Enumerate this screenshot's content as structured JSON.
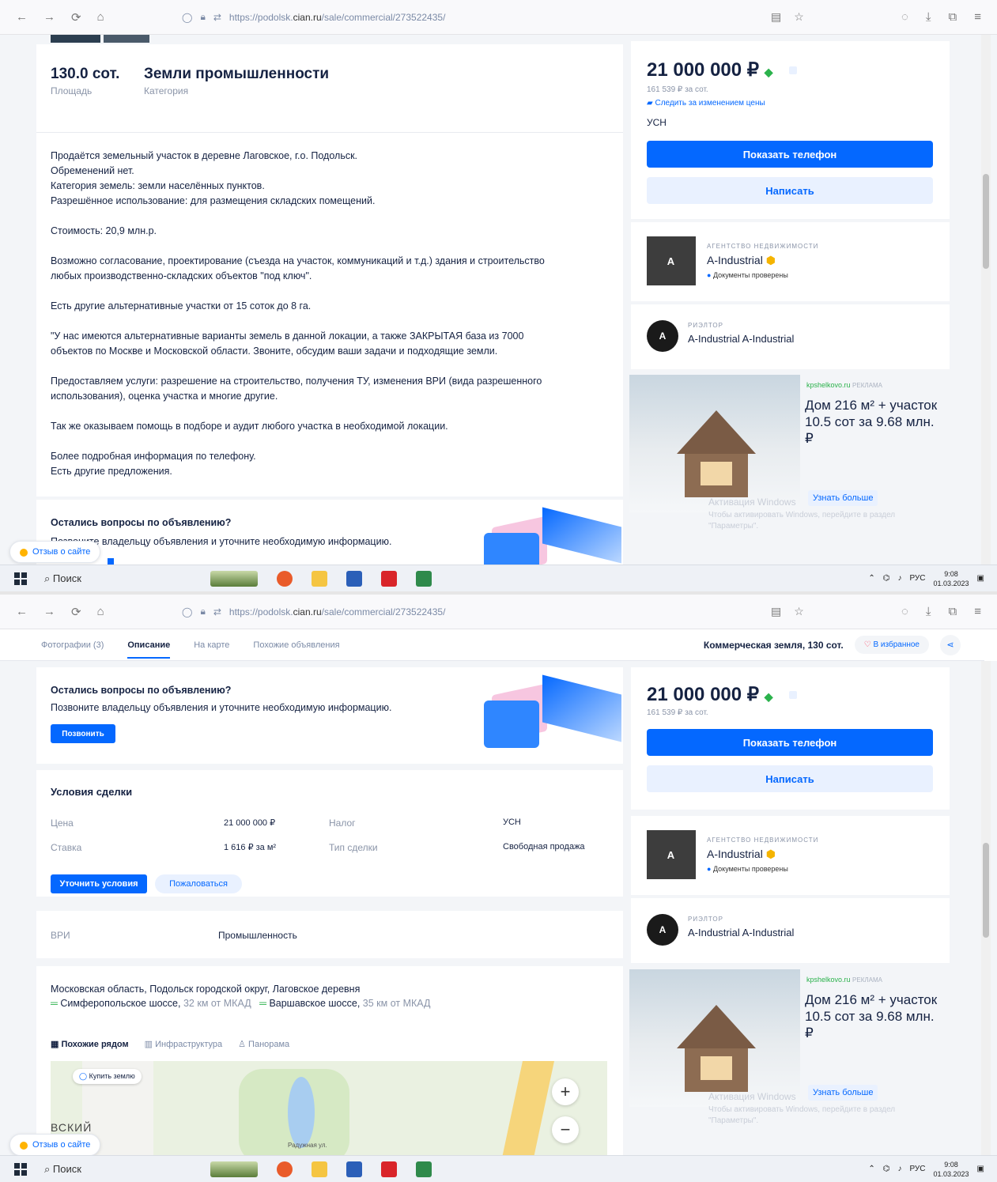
{
  "browser": {
    "url_prefix": "https://podolsk.",
    "url_host": "cian.ru",
    "url_path": "/sale/commercial/273522435/"
  },
  "listing": {
    "area_value": "130.0 сот.",
    "area_label": "Площадь",
    "category_value": "Земли промышленности",
    "category_label": "Категория",
    "description": [
      [
        "Продаётся земельный участок в деревне Лаговское, г.о. Подольск.",
        "Обременений нет.",
        "Категория земель: земли населённых пунктов.",
        "Разрешённое использование: для размещения складских помещений."
      ],
      [
        "Стоимость: 20,9 млн.р."
      ],
      [
        "Возможно согласование, проектирование (съезда на участок, коммуникаций и т.д.) здания и строительство",
        "любых производственно-складских объектов \"под ключ\"."
      ],
      [
        "Есть другие альтернативные участки от 15 соток до 8 га."
      ],
      [
        "\"У нас имеются альтернативные варианты земель в данной локации, а также ЗАКРЫТАЯ база из 7000",
        "объектов по Москве и Московской области. Звоните, обсудим ваши задачи и подходящие земли."
      ],
      [
        "Предоставляем услуги: разрешение на строительство, получения ТУ, изменения ВРИ (вида разрешенного",
        "использования), оценка участка и многие другие."
      ],
      [
        "Так же оказываем помощь в подборе и аудит любого участка в необходимой локации."
      ],
      [
        "Более подробная информация по телефону.",
        "Есть другие предложения."
      ]
    ],
    "questions_title": "Остались вопросы по объявлению?",
    "questions_text": "Позвоните владельцу объявления и уточните необходимую информацию.",
    "call_button": "Позвонить"
  },
  "sidebar": {
    "price": "21 000 000 ₽",
    "price_per": "161 539 ₽ за сот.",
    "follow_price": "Следить за изменением цены",
    "tax": "УСН",
    "show_phone": "Показать телефон",
    "write": "Написать",
    "agency_type": "АГЕНТСТВО НЕДВИЖИМОСТИ",
    "agency_name": "A-Industrial",
    "docs_checked": "Документы проверены",
    "agency_logo": "A",
    "realtor_type": "РИЭЛТОР",
    "realtor_name": "A-Industrial A-Industrial",
    "realtor_avatar": "A"
  },
  "ad": {
    "source": "kpshelkovo.ru",
    "source_tag": "РЕКЛАМА",
    "title": "Дом 216 м² + участок 10.5 сот за 9.68 млн. ₽",
    "cta": "Узнать больше",
    "footer1": "Активация Windows",
    "footer2": "Чтобы активировать Windows, перейдите в раздел",
    "footer3": "\"Параметры\"."
  },
  "feedback": "Отзыв о сайте",
  "taskbar": {
    "search": "Поиск",
    "lang": "РУС",
    "time": "9:08",
    "date": "01.03.2023"
  },
  "tabs": {
    "photos": "Фотографии (3)",
    "description": "Описание",
    "on_map": "На карте",
    "similar": "Похожие объявления",
    "header_title": "Коммерческая земля, 130 сот.",
    "favorite": "В избранное"
  },
  "deal": {
    "title": "Условия сделки",
    "price_label": "Цена",
    "price_value": "21 000 000 ₽",
    "tax_label": "Налог",
    "tax_value": "УСН",
    "rate_label": "Ставка",
    "rate_value": "1 616 ₽ за м²",
    "type_label": "Тип сделки",
    "type_value": "Свободная продажа",
    "clarify_button": "Уточнить условия",
    "complain_button": "Пожаловаться",
    "vri_label": "ВРИ",
    "vri_value": "Промышленность"
  },
  "location": {
    "address": "Московская область, Подольск городской округ, Лаговское деревня",
    "road1": "Симферопольское шоссе,",
    "road1_dist": "32 км от МКАД",
    "road2": "Варшавское шоссе,",
    "road2_dist": "35 км от МКАД",
    "map_tab1": "Похожие рядом",
    "map_tab2": "Инфраструктура",
    "map_tab3": "Панорама",
    "map_chip": "Купить землю",
    "map_label": "ВСКИЙ",
    "map_street": "Радужная ул."
  },
  "colors": {
    "accent": "#0468ff",
    "text": "#152242",
    "muted": "#8a94a8"
  }
}
